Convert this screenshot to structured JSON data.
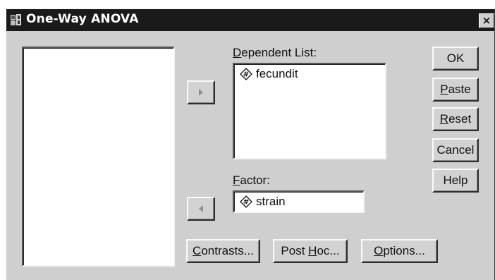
{
  "window": {
    "title": "One-Way ANOVA",
    "close_label": "×"
  },
  "dependent": {
    "label_mnemonic": "D",
    "label_rest": "ependent List:",
    "items": [
      {
        "icon": "numeric-variable-icon",
        "label": "fecundit"
      }
    ]
  },
  "factor": {
    "label_mnemonic": "F",
    "label_rest": "actor:",
    "item": {
      "icon": "numeric-variable-icon",
      "label": "strain"
    }
  },
  "buttons": {
    "ok": "OK",
    "paste": {
      "mnemonic": "P",
      "rest": "aste"
    },
    "reset": {
      "mnemonic": "R",
      "rest": "eset"
    },
    "cancel": "Cancel",
    "help": "Help",
    "contrasts": {
      "mnemonic": "C",
      "rest": "ontrasts..."
    },
    "posthoc": {
      "pre": "Post ",
      "mnemonic": "H",
      "rest": "oc..."
    },
    "options": {
      "mnemonic": "O",
      "rest": "ptions..."
    }
  },
  "colors": {
    "titlebar": "#1a1a1a",
    "dialog": "#cfcfcf",
    "list_bg": "#ffffff"
  }
}
